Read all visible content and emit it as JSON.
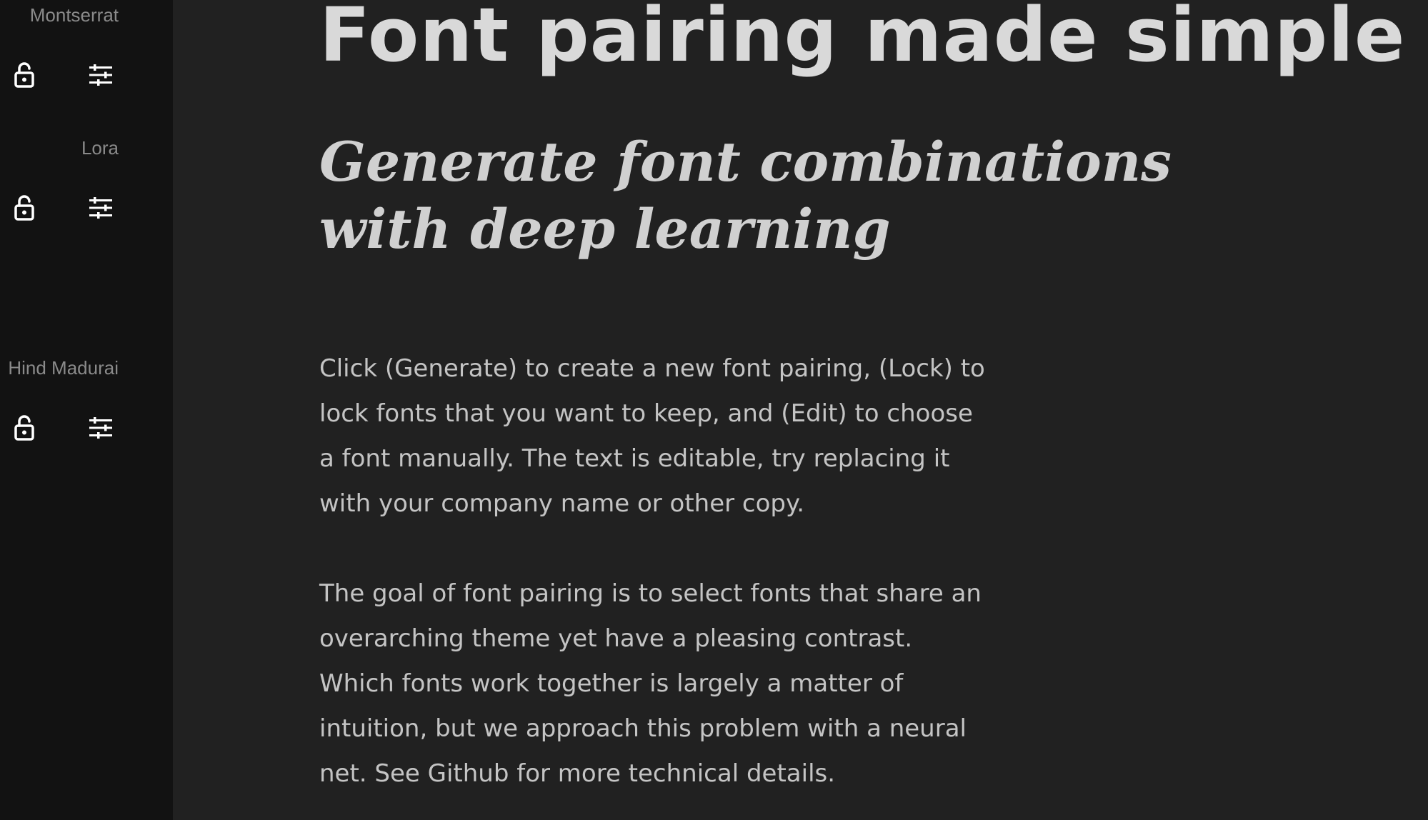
{
  "sidebar": {
    "fonts": [
      {
        "name": "Montserrat",
        "lock_icon": "lock-open-icon",
        "edit_icon": "sliders-icon"
      },
      {
        "name": "Lora",
        "lock_icon": "lock-open-icon",
        "edit_icon": "sliders-icon"
      },
      {
        "name": "Hind Madurai",
        "lock_icon": "lock-open-icon",
        "edit_icon": "sliders-icon"
      }
    ]
  },
  "main": {
    "headline": "Font pairing made simple",
    "subheadline": "Generate font combinations with deep learning",
    "paragraphs": [
      "Click (Generate) to create a new font pairing, (Lock) to lock fonts that you want to keep, and (Edit) to choose a font manually. The text is editable, try replacing it with your company name or other copy.",
      "The goal of font pairing is to select fonts that share an overarching theme yet have a pleasing contrast. Which fonts work together is largely a matter of intuition, but we approach this problem with a neural net. See Github for more technical details."
    ]
  },
  "colors": {
    "sidebar_bg": "#121212",
    "main_bg": "#212121",
    "icon": "#ffffff",
    "font_label": "#8a8a8a"
  }
}
